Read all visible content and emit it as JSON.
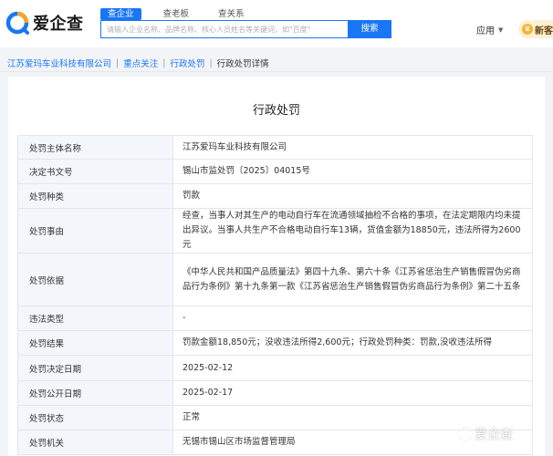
{
  "header": {
    "logo_text": "爱企查",
    "tabs": [
      {
        "label": "查企业",
        "active": true
      },
      {
        "label": "查老板",
        "active": false
      },
      {
        "label": "查关系",
        "active": false
      }
    ],
    "search_placeholder": "请输入企业名称、品牌名称、核心人员姓名等关键词，如\"百度\"",
    "search_button": "搜索",
    "apps_label": "应用",
    "vip_label": "新客"
  },
  "breadcrumb": {
    "items": [
      "江苏爱玛车业科技有限公司",
      "重点关注",
      "行政处罚"
    ],
    "current": "行政处罚详情",
    "separator": "|"
  },
  "detail": {
    "title": "行政处罚",
    "rows": [
      {
        "label": "处罚主体名称",
        "value": "江苏爱玛车业科技有限公司"
      },
      {
        "label": "决定书文号",
        "value": "锡山市监处罚〔2025〕04015号"
      },
      {
        "label": "处罚种类",
        "value": "罚款"
      },
      {
        "label": "处罚事由",
        "value": "经查，当事人对其生产的电动自行车在流通领域抽检不合格的事项，在法定期限内均未提出异议。当事人共生产不合格电动自行车13辆，货值金额为18850元，违法所得为2600元"
      },
      {
        "label": "处罚依据",
        "value": "《中华人民共和国产品质量法》第四十九条、第六十条《江苏省惩治生产销售假冒伪劣商品行为条例》第十九条第一款《江苏省惩治生产销售假冒伪劣商品行为条例》第二十五条"
      },
      {
        "label": "违法类型",
        "value": "-"
      },
      {
        "label": "处罚结果",
        "value": "罚款金额18,850元；没收违法所得2,600元；行政处罚种类：罚款,没收违法所得"
      },
      {
        "label": "处罚决定日期",
        "value": "2025-02-12"
      },
      {
        "label": "处罚公开日期",
        "value": "2025-02-17"
      },
      {
        "label": "处罚状态",
        "value": "正常"
      },
      {
        "label": "处罚机关",
        "value": "无锡市锡山区市场监督管理局"
      }
    ]
  },
  "watermark": "爱企查",
  "colors": {
    "accent": "#1976f5",
    "label_bg": "#f3f6fb"
  }
}
